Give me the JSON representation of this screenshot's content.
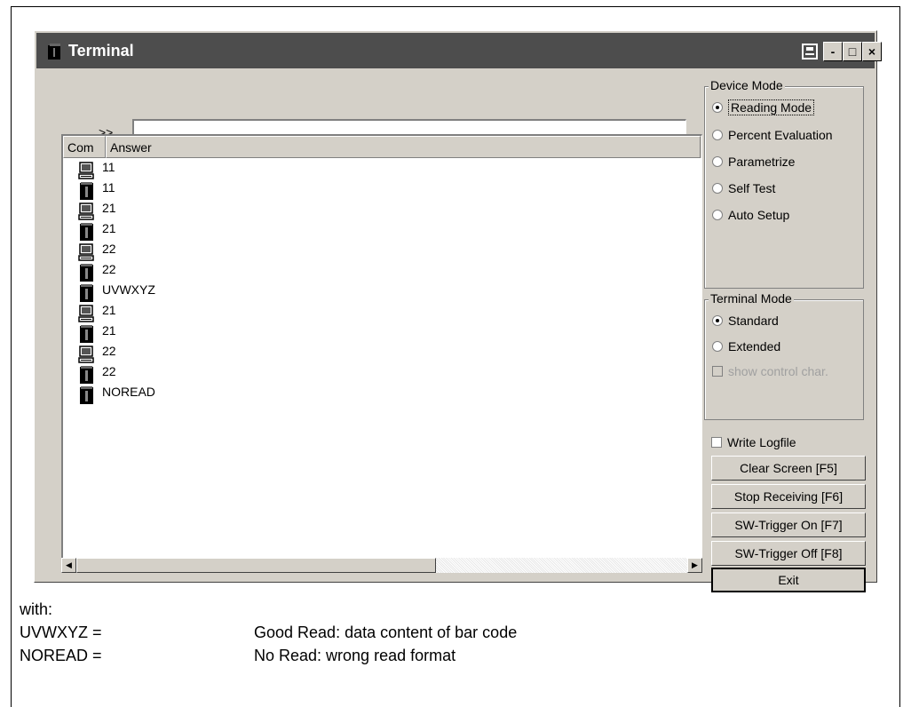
{
  "window": {
    "title": "Terminal"
  },
  "titlebar_buttons": [
    {
      "name": "print-icon",
      "glyph": "⎙"
    },
    {
      "name": "minimize-button",
      "glyph": "-"
    },
    {
      "name": "maximize-button",
      "glyph": "□"
    },
    {
      "name": "close-button",
      "glyph": "×"
    }
  ],
  "command": {
    "prompt": ">>",
    "value": ""
  },
  "list": {
    "columns": [
      "Com",
      "Answer"
    ],
    "rows": [
      {
        "icon": "pc-icon",
        "text": "11"
      },
      {
        "icon": "scanner-icon",
        "text": "11"
      },
      {
        "icon": "pc-icon",
        "text": "21"
      },
      {
        "icon": "scanner-icon",
        "text": "21"
      },
      {
        "icon": "pc-icon",
        "text": "22"
      },
      {
        "icon": "scanner-icon",
        "text": "22"
      },
      {
        "icon": "scanner-icon",
        "text": "UVWXYZ"
      },
      {
        "icon": "pc-icon",
        "text": "21"
      },
      {
        "icon": "scanner-icon",
        "text": "21"
      },
      {
        "icon": "pc-icon",
        "text": "22"
      },
      {
        "icon": "scanner-icon",
        "text": "22"
      },
      {
        "icon": "scanner-icon",
        "text": "NOREAD"
      }
    ]
  },
  "device_mode": {
    "title": "Device Mode",
    "options": [
      "Reading Mode",
      "Percent Evaluation",
      "Parametrize",
      "Self Test",
      "Auto Setup"
    ],
    "selected": "Reading Mode"
  },
  "terminal_mode": {
    "title": "Terminal Mode",
    "options": [
      "Standard",
      "Extended"
    ],
    "selected": "Standard",
    "show_control_char": "show control char."
  },
  "write_logfile": "Write Logfile",
  "buttons": {
    "clear": "Clear Screen [F5]",
    "stop": "Stop Receiving [F6]",
    "trigger_on": "SW-Trigger On [F7]",
    "trigger_off": "SW-Trigger Off [F8]",
    "exit": "Exit"
  },
  "legend": {
    "intro": "with:",
    "items": [
      {
        "term": "UVWXYZ =",
        "desc": "Good Read: data content of bar code"
      },
      {
        "term": "NOREAD =",
        "desc": "No Read: wrong read format"
      }
    ]
  }
}
